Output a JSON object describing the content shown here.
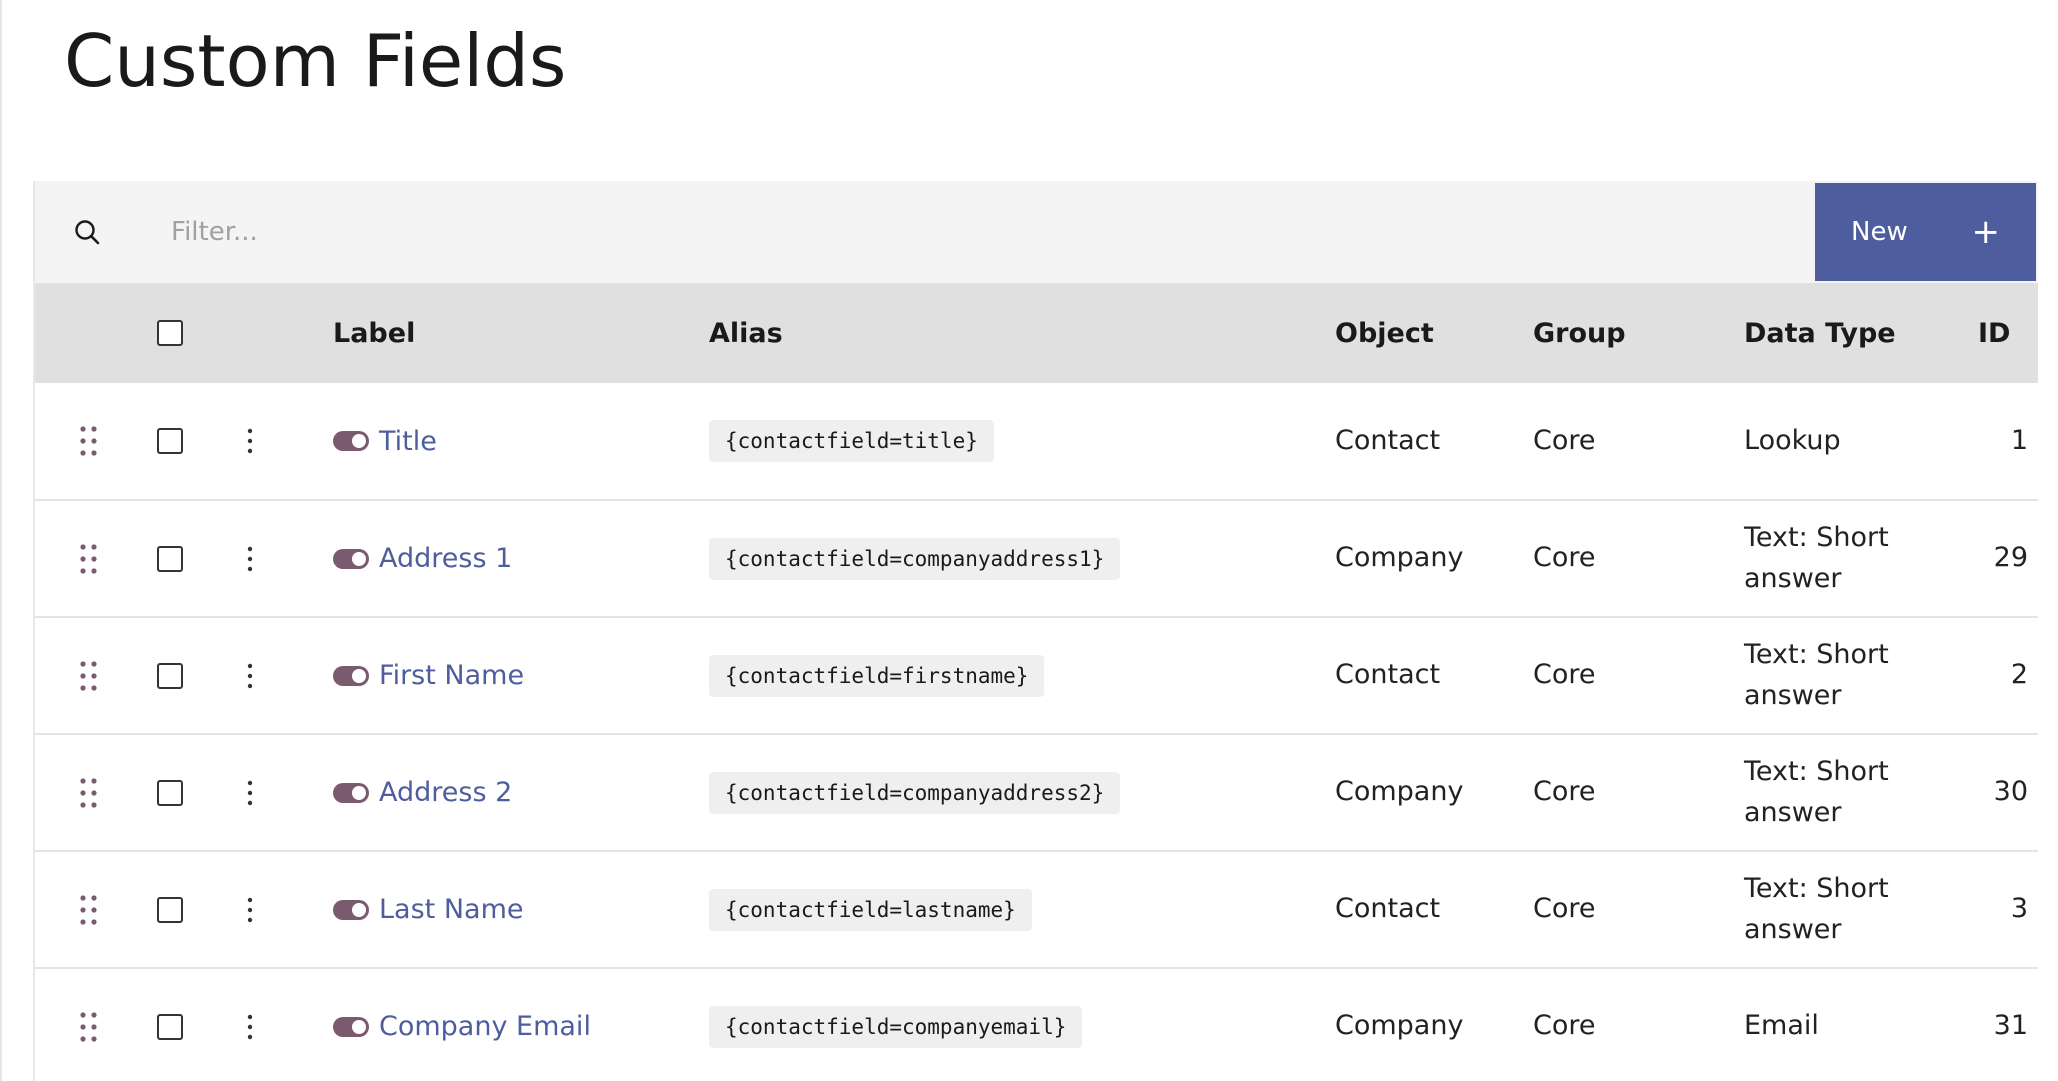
{
  "page": {
    "title": "Custom Fields"
  },
  "toolbar": {
    "filter_placeholder": "Filter...",
    "new_label": "New",
    "new_icon": "plus-icon",
    "accent_color": "#4e5d9d"
  },
  "table": {
    "columns": [
      "Label",
      "Alias",
      "Object",
      "Group",
      "Data Type",
      "ID"
    ],
    "rows": [
      {
        "label": "Title",
        "alias": "{contactfield=title}",
        "object": "Contact",
        "group": "Core",
        "data_type": "Lookup",
        "id": "1"
      },
      {
        "label": "Address 1",
        "alias": "{contactfield=companyaddress1}",
        "object": "Company",
        "group": "Core",
        "data_type": "Text: Short answer",
        "id": "29"
      },
      {
        "label": "First Name",
        "alias": "{contactfield=firstname}",
        "object": "Contact",
        "group": "Core",
        "data_type": "Text: Short answer",
        "id": "2"
      },
      {
        "label": "Address 2",
        "alias": "{contactfield=companyaddress2}",
        "object": "Company",
        "group": "Core",
        "data_type": "Text: Short answer",
        "id": "30"
      },
      {
        "label": "Last Name",
        "alias": "{contactfield=lastname}",
        "object": "Contact",
        "group": "Core",
        "data_type": "Text: Short answer",
        "id": "3"
      },
      {
        "label": "Company Email",
        "alias": "{contactfield=companyemail}",
        "object": "Company",
        "group": "Core",
        "data_type": "Email",
        "id": "31"
      }
    ]
  },
  "icons": {
    "search": "search-icon",
    "drag": "drag-handle-icon",
    "menu": "kebab-menu-icon",
    "toggle": "toggle-on-icon"
  },
  "colors": {
    "link": "#4e5d9d",
    "toggle": "#7a5a6f",
    "header_bg": "#e0e0e0",
    "toolbar_bg": "#f4f4f4"
  }
}
